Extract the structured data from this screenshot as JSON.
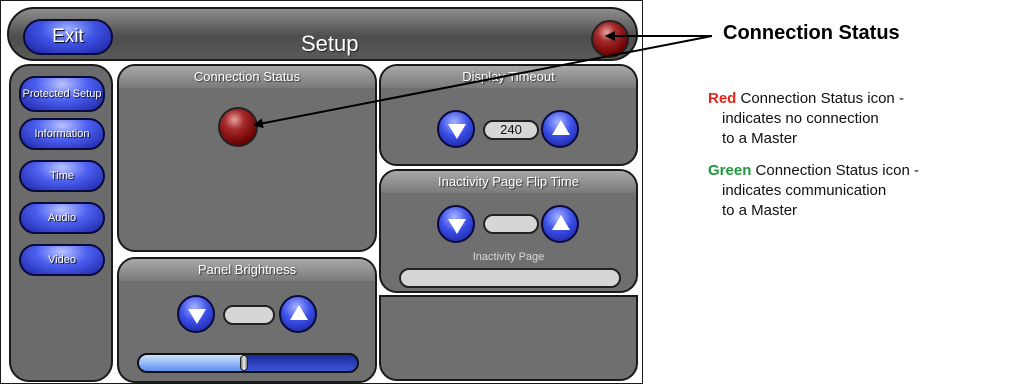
{
  "header": {
    "exit_label": "Exit",
    "title": "Setup"
  },
  "sidebar": {
    "items": [
      {
        "label": "Protected Setup"
      },
      {
        "label": "Information"
      },
      {
        "label": "Time"
      },
      {
        "label": "Audio"
      },
      {
        "label": "Video"
      }
    ]
  },
  "panels": {
    "connection_status": {
      "title": "Connection Status"
    },
    "display_timeout": {
      "title": "Display Timeout",
      "value": "240"
    },
    "inactivity": {
      "title": "Inactivity Page Flip Time",
      "value": "",
      "page_label": "Inactivity Page",
      "page_value": ""
    },
    "panel_brightness": {
      "title": "Panel Brightness",
      "value": "",
      "slider_level": 0.48
    }
  },
  "annotation": {
    "title": "Connection Status",
    "red": {
      "word": "Red",
      "line1": " Connection Status icon -",
      "line2": "indicates no connection",
      "line3": "to a Master",
      "color": "#e0261b"
    },
    "green": {
      "word": "Green",
      "line1": " Connection Status icon -",
      "line2": "indicates communication",
      "line3": "to a Master",
      "color": "#1f9a3c"
    }
  },
  "icons": {
    "header_status": "red-status-led-icon",
    "panel_status": "red-status-led-icon",
    "down": "down-arrow-icon",
    "up": "up-arrow-icon"
  }
}
